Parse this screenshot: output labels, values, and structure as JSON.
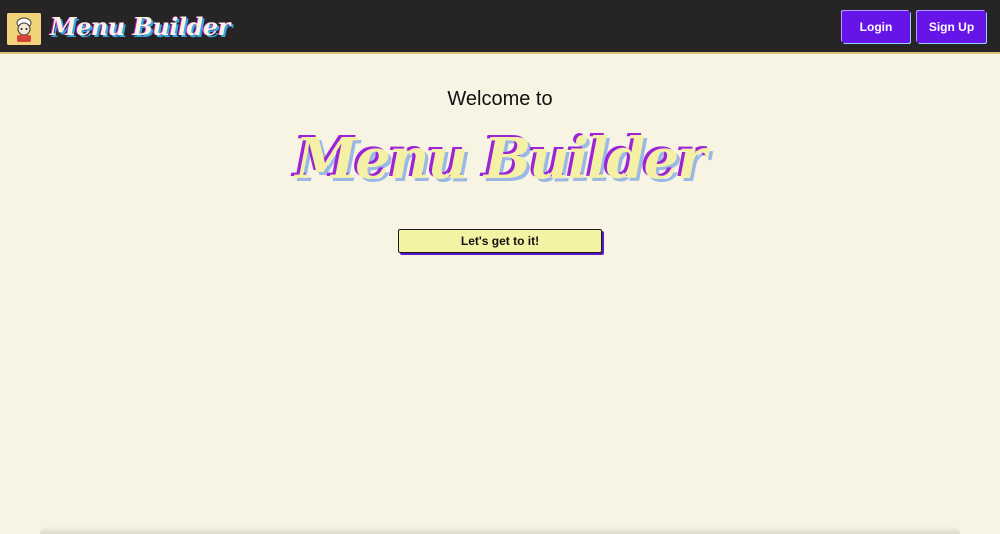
{
  "navbar": {
    "brand": "Menu Builder",
    "login_label": "Login",
    "signup_label": "Sign Up",
    "logo_icon": "chef-avatar-icon"
  },
  "hero": {
    "welcome_text": "Welcome to",
    "title": "Menu Builder",
    "cta_label": "Let's get to it!"
  },
  "colors": {
    "navbar_bg": "#262425",
    "page_bg": "#f7f4e4",
    "accent_purple": "#6714e8",
    "cta_bg": "#f4f3a4",
    "title_fill": "#f4f0a6",
    "title_outline": "#9c23d7"
  }
}
